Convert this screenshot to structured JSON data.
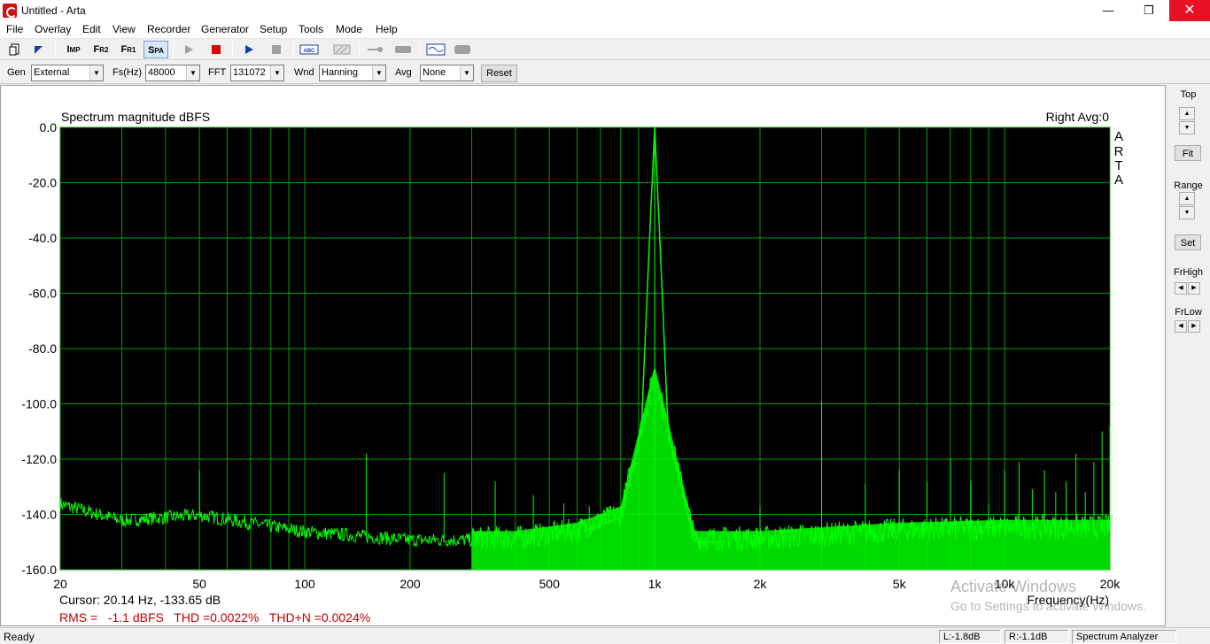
{
  "window": {
    "title": "Untitled - Arta",
    "minimize": "—",
    "maximize": "❒",
    "close": "✕"
  },
  "menu": [
    "File",
    "Overlay",
    "Edit",
    "View",
    "Recorder",
    "Generator",
    "Setup",
    "Tools",
    "Mode",
    "Help"
  ],
  "toolbar": {
    "imp": {
      "big": "I",
      "small": "MP"
    },
    "fr2": {
      "big": "F",
      "small": "R2"
    },
    "fr1": {
      "big": "F",
      "small": "R1"
    },
    "spa": {
      "big": "S",
      "small": "PA"
    },
    "abc": "ABC"
  },
  "controls": {
    "gen_label": "Gen",
    "gen_value": "External",
    "fs_label": "Fs(Hz)",
    "fs_value": "48000",
    "fft_label": "FFT",
    "fft_value": "131072",
    "wnd_label": "Wnd",
    "wnd_value": "Hanning",
    "avg_label": "Avg",
    "avg_value": "None",
    "reset": "Reset"
  },
  "side": {
    "top": "Top",
    "fit": "Fit",
    "range": "Range",
    "set": "Set",
    "frhigh": "FrHigh",
    "frlow": "FrLow"
  },
  "plot": {
    "cursor": "Cursor: 20.14 Hz, -133.65 dB",
    "stats": "RMS =   -1.1 dBFS   THD =0.0022%   THD+N =0.0024%",
    "channel": "Right  Avg:0",
    "brand": [
      "A",
      "R",
      "T",
      "A"
    ],
    "colors": {
      "background": "#000000",
      "grid": "#00a000",
      "trace": "#00ff00",
      "stats_text": "#c00000"
    }
  },
  "watermark": {
    "line1": "Activate Windows",
    "line2": "Go to Settings to activate Windows."
  },
  "status": {
    "ready": "Ready",
    "left": "L:-1.8dB",
    "right": "R:-1.1dB",
    "mode": "Spectrum Analyzer"
  },
  "chart_data": {
    "type": "line",
    "title": "Spectrum magnitude dBFS",
    "xlabel": "Frequency(Hz)",
    "ylabel": "",
    "x_scale": "log",
    "xlim": [
      20,
      20000
    ],
    "ylim": [
      -160,
      0
    ],
    "grid": true,
    "x_ticks": [
      20,
      50,
      100,
      200,
      500,
      1000,
      2000,
      5000,
      10000,
      20000
    ],
    "x_tick_labels": [
      "20",
      "50",
      "100",
      "200",
      "500",
      "1k",
      "2k",
      "5k",
      "10k",
      "20k"
    ],
    "y_ticks": [
      0,
      -20,
      -40,
      -60,
      -80,
      -100,
      -120,
      -140,
      -160
    ],
    "y_tick_labels": [
      "0.0",
      "-20.0",
      "-40.0",
      "-60.0",
      "-80.0",
      "-100.0",
      "-120.0",
      "-140.0",
      "-160.0"
    ],
    "series": [
      {
        "color": "#00ff00",
        "fundamental": {
          "x": 1000,
          "y": 0
        },
        "noise_floor": [
          [
            20,
            -137
          ],
          [
            30,
            -143
          ],
          [
            50,
            -141
          ],
          [
            100,
            -147
          ],
          [
            200,
            -150
          ],
          [
            400,
            -150
          ],
          [
            600,
            -147
          ],
          [
            800,
            -141
          ],
          [
            1000,
            -90
          ],
          [
            1300,
            -150
          ],
          [
            2000,
            -150
          ],
          [
            5000,
            -147
          ],
          [
            10000,
            -146
          ],
          [
            20000,
            -146
          ]
        ],
        "spurs": [
          [
            50,
            -124
          ],
          [
            150,
            -118
          ],
          [
            250,
            -125
          ],
          [
            350,
            -128
          ],
          [
            450,
            -133
          ],
          [
            550,
            -136
          ],
          [
            650,
            -137
          ],
          [
            2000,
            -137
          ],
          [
            3000,
            -99
          ],
          [
            4000,
            -129
          ],
          [
            5000,
            -124
          ],
          [
            6000,
            -128
          ],
          [
            7000,
            -120
          ],
          [
            8000,
            -128
          ],
          [
            9000,
            -136
          ],
          [
            10000,
            -124
          ],
          [
            11000,
            -121
          ],
          [
            12000,
            -131
          ],
          [
            13000,
            -124
          ],
          [
            14000,
            -132
          ],
          [
            15000,
            -128
          ],
          [
            16000,
            -118
          ],
          [
            17000,
            -132
          ],
          [
            18000,
            -121
          ],
          [
            19000,
            -110
          ],
          [
            20000,
            -108
          ]
        ]
      }
    ]
  }
}
